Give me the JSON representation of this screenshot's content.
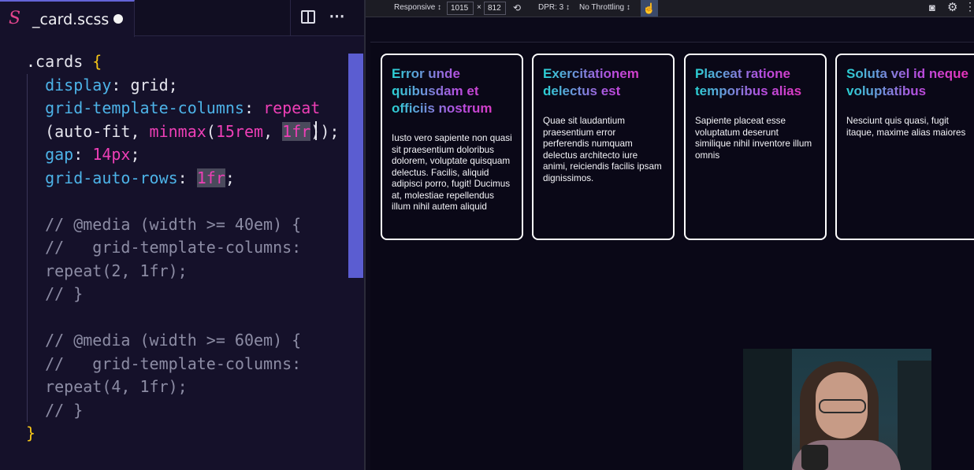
{
  "editor": {
    "tab": {
      "icon": "sass-icon",
      "title": "_card.scss",
      "dirty": true
    },
    "actions": [
      "split-editor-icon",
      "more-actions-icon"
    ],
    "code_lines": [
      [
        {
          "t": ".cards ",
          "c": "sel"
        },
        {
          "t": "{",
          "c": "brace"
        }
      ],
      [
        {
          "t": "  "
        },
        {
          "t": "display",
          "c": "prop"
        },
        {
          "t": ": grid;"
        }
      ],
      [
        {
          "t": "  "
        },
        {
          "t": "grid-template-columns",
          "c": "prop"
        },
        {
          "t": ": "
        },
        {
          "t": "repeat",
          "c": "fn"
        }
      ],
      [
        {
          "t": "  (auto-fit, "
        },
        {
          "t": "minmax",
          "c": "fn"
        },
        {
          "t": "("
        },
        {
          "t": "15rem",
          "c": "num"
        },
        {
          "t": ", "
        },
        {
          "t": "1fr",
          "c": "num hl"
        },
        {
          "t": "));"
        }
      ],
      [
        {
          "t": "  "
        },
        {
          "t": "gap",
          "c": "prop"
        },
        {
          "t": ": "
        },
        {
          "t": "14px",
          "c": "num"
        },
        {
          "t": ";"
        }
      ],
      [
        {
          "t": "  "
        },
        {
          "t": "grid-auto-rows",
          "c": "prop"
        },
        {
          "t": ": "
        },
        {
          "t": "1fr",
          "c": "num hl"
        },
        {
          "t": ";"
        }
      ],
      [
        {
          "t": ""
        }
      ],
      [
        {
          "t": "  // @media (width >= 40em) {",
          "c": "cmt"
        }
      ],
      [
        {
          "t": "  //   grid-template-columns:",
          "c": "cmt"
        }
      ],
      [
        {
          "t": "  repeat(2, 1fr);",
          "c": "cmt"
        }
      ],
      [
        {
          "t": "  // }",
          "c": "cmt"
        }
      ],
      [
        {
          "t": ""
        }
      ],
      [
        {
          "t": "  // @media (width >= 60em) {",
          "c": "cmt"
        }
      ],
      [
        {
          "t": "  //   grid-template-columns:",
          "c": "cmt"
        }
      ],
      [
        {
          "t": "  repeat(4, 1fr);",
          "c": "cmt"
        }
      ],
      [
        {
          "t": "  // }",
          "c": "cmt"
        }
      ],
      [
        {
          "t": "}",
          "c": "brace"
        }
      ]
    ]
  },
  "devtools": {
    "device": "Responsive ↕",
    "width": "1015",
    "times": "×",
    "height": "812",
    "dpr": "DPR: 3 ↕",
    "throttling": "No Throttling ↕"
  },
  "cards": [
    {
      "title": "Error unde quibusdam et officiis nostrum",
      "body": "Iusto vero sapiente non quasi sit praesentium doloribus dolorem, voluptate quisquam delectus. Facilis, aliquid adipisci porro, fugit! Ducimus at, molestiae repellendus illum nihil autem aliquid"
    },
    {
      "title": "Exercitationem delectus est",
      "body": "Quae sit laudantium praesentium error perferendis numquam delectus architecto iure animi, reiciendis facilis ipsam dignissimos."
    },
    {
      "title": "Placeat ratione temporibus alias",
      "body": "Sapiente placeat esse voluptatum deserunt similique nihil inventore illum omnis"
    },
    {
      "title": "Soluta vel id neque voluptatibus",
      "body": "Nesciunt quis quasi, fugit itaque, maxime alias maiores"
    }
  ],
  "colors": {
    "accent": "#5b5dd1",
    "title_gradient": [
      "#29d2d4",
      "#b44fe0",
      "#ee2fb4"
    ]
  }
}
